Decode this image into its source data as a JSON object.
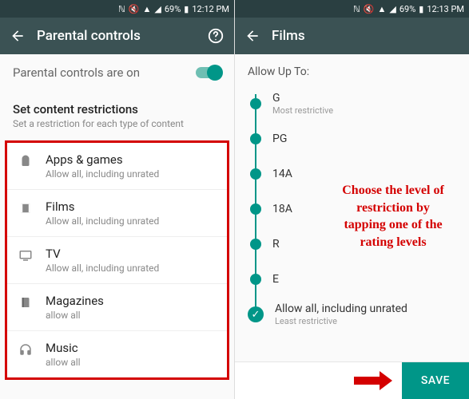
{
  "left": {
    "status": {
      "battery": "69%",
      "time": "12:12 PM"
    },
    "appbar": {
      "title": "Parental controls"
    },
    "toggle": {
      "label": "Parental controls are on"
    },
    "section": {
      "head": "Set content restrictions",
      "sub": "Set a restriction for each type of content"
    },
    "items": [
      {
        "icon": "android",
        "title": "Apps & games",
        "sub": "Allow all, including unrated"
      },
      {
        "icon": "film",
        "title": "Films",
        "sub": "Allow all, including unrated"
      },
      {
        "icon": "tv",
        "title": "TV",
        "sub": "Allow all, including unrated"
      },
      {
        "icon": "book",
        "title": "Magazines",
        "sub": "allow all"
      },
      {
        "icon": "headphones",
        "title": "Music",
        "sub": "allow all"
      }
    ]
  },
  "right": {
    "status": {
      "battery": "69%",
      "time": "12:13 PM"
    },
    "appbar": {
      "title": "Films"
    },
    "allowupto": "Allow Up To:",
    "ratings": [
      {
        "label": "G",
        "sub": "Most restrictive"
      },
      {
        "label": "PG",
        "sub": ""
      },
      {
        "label": "14A",
        "sub": ""
      },
      {
        "label": "18A",
        "sub": ""
      },
      {
        "label": "R",
        "sub": ""
      },
      {
        "label": "E",
        "sub": ""
      },
      {
        "label": "Allow all, including unrated",
        "sub": "Least restrictive"
      }
    ],
    "save": "SAVE",
    "annotation": "Choose the level of restriction by tapping one of the rating levels"
  }
}
